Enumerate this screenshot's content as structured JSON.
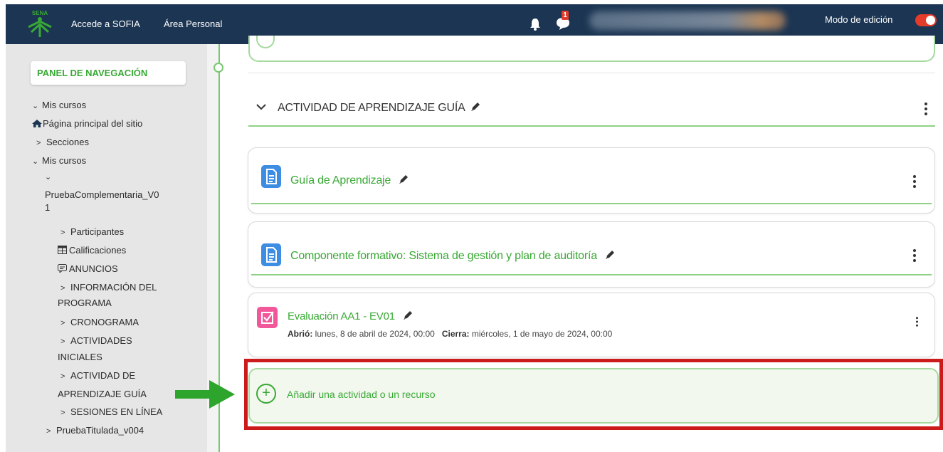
{
  "colors": {
    "topbar": "#1b3552",
    "accent_green": "#39a935",
    "highlight_red": "#cc1b1b",
    "toggle_on": "#e53b2a"
  },
  "header": {
    "logo_text": "SENA",
    "link_sofia": "Accede a SOFIA",
    "link_personal": "Área Personal",
    "notification_icon": "bell-icon",
    "messages_badge": "1",
    "edit_mode_label": "Modo de edición",
    "edit_mode_on": true
  },
  "sidebar": {
    "panel_title": "PANEL DE NAVEGACIÓN",
    "mis_cursos_1": "Mis cursos",
    "home": "Página principal del sitio",
    "secciones": "Secciones",
    "mis_cursos_2": "Mis cursos",
    "course_line1": "PruebaComplementaria_V0",
    "course_line2": "1",
    "participantes": "Participantes",
    "calificaciones": "Calificaciones",
    "anuncios": "ANUNCIOS",
    "info_line1": "INFORMACIÓN DEL",
    "info_line2": "PROGRAMA",
    "cronograma": "CRONOGRAMA",
    "actividades_line1": "ACTIVIDADES",
    "actividades_line2": "INICIALES",
    "aprendizaje_line1": "ACTIVIDAD DE",
    "aprendizaje_line2": "APRENDIZAJE GUÍA",
    "sesiones": "SESIONES EN LÍNEA",
    "titulada": "PruebaTitulada_v004"
  },
  "main": {
    "section_title": "ACTIVIDAD DE APRENDIZAJE GUÍA",
    "activities": [
      {
        "title": "Guía de Aprendizaje",
        "icon": "document-icon"
      },
      {
        "title": "Componente formativo: Sistema de gestión y plan de auditoría",
        "icon": "document-icon"
      },
      {
        "title": "Evaluación AA1 - EV01",
        "icon": "quiz-icon",
        "opened_label": "Abrió:",
        "opened_value": "lunes, 8 de abril de 2024, 00:00",
        "closes_label": "Cierra:",
        "closes_value": "miércoles, 1 de mayo de 2024, 00:00"
      }
    ],
    "add_activity_label": "Añadir una actividad o un recurso"
  }
}
